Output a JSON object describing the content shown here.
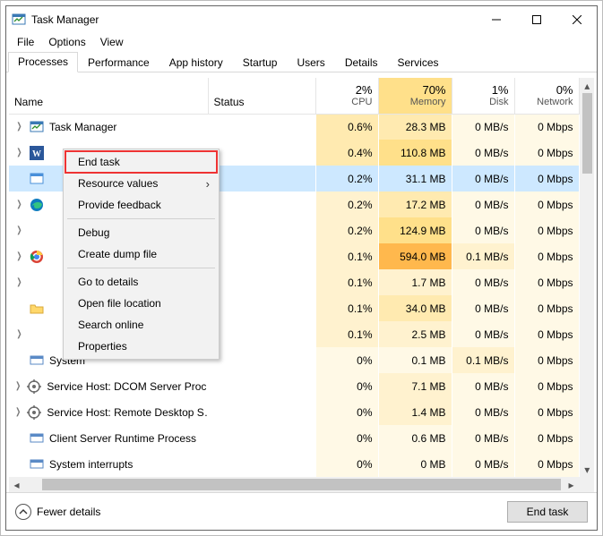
{
  "window": {
    "title": "Task Manager"
  },
  "menubar": [
    "File",
    "Options",
    "View"
  ],
  "tabs": [
    "Processes",
    "Performance",
    "App history",
    "Startup",
    "Users",
    "Details",
    "Services"
  ],
  "active_tab": 0,
  "columns": {
    "name": "Name",
    "status": "Status",
    "cpu": {
      "pct": "2%",
      "label": "CPU"
    },
    "mem": {
      "pct": "70%",
      "label": "Memory"
    },
    "disk": {
      "pct": "1%",
      "label": "Disk"
    },
    "net": {
      "pct": "0%",
      "label": "Network"
    }
  },
  "rows": [
    {
      "icon": "tm",
      "expand": true,
      "name": "Task Manager",
      "cpu": "0.6%",
      "mem": "28.3 MB",
      "disk": "0 MB/s",
      "net": "0 Mbps",
      "cpu_h": "heat2",
      "mem_h": "heat2",
      "disk_h": "heat0",
      "net_h": "heat0"
    },
    {
      "icon": "word",
      "expand": true,
      "name": "",
      "cpu": "0.4%",
      "mem": "110.8 MB",
      "disk": "0 MB/s",
      "net": "0 Mbps",
      "cpu_h": "heat2",
      "mem_h": "heat3",
      "disk_h": "heat0",
      "net_h": "heat0"
    },
    {
      "icon": "winexp",
      "expand": false,
      "name": "",
      "cpu": "0.2%",
      "mem": "31.1 MB",
      "disk": "0 MB/s",
      "net": "0 Mbps",
      "cpu_h": "heat1",
      "mem_h": "heat2",
      "disk_h": "heat0",
      "net_h": "heat0",
      "selected": true
    },
    {
      "icon": "edge",
      "expand": true,
      "name": "",
      "cpu": "0.2%",
      "mem": "17.2 MB",
      "disk": "0 MB/s",
      "net": "0 Mbps",
      "cpu_h": "heat1",
      "mem_h": "heat2",
      "disk_h": "heat0",
      "net_h": "heat0"
    },
    {
      "icon": "blank",
      "expand": true,
      "name": "",
      "cpu": "0.2%",
      "mem": "124.9 MB",
      "disk": "0 MB/s",
      "net": "0 Mbps",
      "cpu_h": "heat1",
      "mem_h": "heat3",
      "disk_h": "heat0",
      "net_h": "heat0"
    },
    {
      "icon": "chrome",
      "expand": true,
      "name": "",
      "cpu": "0.1%",
      "mem": "594.0 MB",
      "disk": "0.1 MB/s",
      "net": "0 Mbps",
      "cpu_h": "heat1",
      "mem_h": "heat5",
      "disk_h": "heat1",
      "net_h": "heat0"
    },
    {
      "icon": "blank",
      "expand": true,
      "name": "",
      "cpu": "0.1%",
      "mem": "1.7 MB",
      "disk": "0 MB/s",
      "net": "0 Mbps",
      "cpu_h": "heat1",
      "mem_h": "heat1",
      "disk_h": "heat0",
      "net_h": "heat0"
    },
    {
      "icon": "folder",
      "expand": false,
      "name": "",
      "cpu": "0.1%",
      "mem": "34.0 MB",
      "disk": "0 MB/s",
      "net": "0 Mbps",
      "cpu_h": "heat1",
      "mem_h": "heat2",
      "disk_h": "heat0",
      "net_h": "heat0"
    },
    {
      "icon": "blank",
      "expand": true,
      "name": "",
      "cpu": "0.1%",
      "mem": "2.5 MB",
      "disk": "0 MB/s",
      "net": "0 Mbps",
      "cpu_h": "heat1",
      "mem_h": "heat1",
      "disk_h": "heat0",
      "net_h": "heat0"
    },
    {
      "icon": "sys",
      "expand": false,
      "name": "System",
      "cpu": "0%",
      "mem": "0.1 MB",
      "disk": "0.1 MB/s",
      "net": "0 Mbps",
      "cpu_h": "heat0",
      "mem_h": "heat0",
      "disk_h": "heat1",
      "net_h": "heat0"
    },
    {
      "icon": "svc",
      "expand": true,
      "name": "Service Host: DCOM Server Proc…",
      "cpu": "0%",
      "mem": "7.1 MB",
      "disk": "0 MB/s",
      "net": "0 Mbps",
      "cpu_h": "heat0",
      "mem_h": "heat1",
      "disk_h": "heat0",
      "net_h": "heat0"
    },
    {
      "icon": "svc",
      "expand": true,
      "name": "Service Host: Remote Desktop S…",
      "cpu": "0%",
      "mem": "1.4 MB",
      "disk": "0 MB/s",
      "net": "0 Mbps",
      "cpu_h": "heat0",
      "mem_h": "heat1",
      "disk_h": "heat0",
      "net_h": "heat0"
    },
    {
      "icon": "sys",
      "expand": false,
      "name": "Client Server Runtime Process",
      "cpu": "0%",
      "mem": "0.6 MB",
      "disk": "0 MB/s",
      "net": "0 Mbps",
      "cpu_h": "heat0",
      "mem_h": "heat0",
      "disk_h": "heat0",
      "net_h": "heat0"
    },
    {
      "icon": "sys",
      "expand": false,
      "name": "System interrupts",
      "cpu": "0%",
      "mem": "0 MB",
      "disk": "0 MB/s",
      "net": "0 Mbps",
      "cpu_h": "heat0",
      "mem_h": "heat0",
      "disk_h": "heat0",
      "net_h": "heat0"
    }
  ],
  "context_menu": [
    {
      "label": "End task",
      "highlight": true
    },
    {
      "label": "Resource values",
      "submenu": true
    },
    {
      "label": "Provide feedback"
    },
    {
      "sep": true
    },
    {
      "label": "Debug"
    },
    {
      "label": "Create dump file"
    },
    {
      "sep": true
    },
    {
      "label": "Go to details"
    },
    {
      "label": "Open file location"
    },
    {
      "label": "Search online"
    },
    {
      "label": "Properties"
    }
  ],
  "footer": {
    "fewer": "Fewer details",
    "end_task": "End task"
  },
  "icons_svg": {
    "tm": "<svg width='16' height='16'><rect x='1' y='2' width='14' height='11' fill='#fff' stroke='#3a79b5'/><rect x='1' y='2' width='14' height='3' fill='#3a79b5'/><polyline points='3,10 6,7 8,9 12,5' fill='none' stroke='#2d8f2d' stroke-width='1.3'/></svg>",
    "word": "<svg width='16' height='16'><rect width='16' height='16' fill='#2b579a'/><text x='8' y='12' font-size='10' fill='#fff' text-anchor='middle' font-family='Segoe UI' font-weight='bold'>W</text></svg>",
    "winexp": "<svg width='16' height='16'><rect x='1' y='2' width='14' height='11' fill='#fff' stroke='#4a90d9'/><rect x='1' y='2' width='14' height='3' fill='#4a90d9'/></svg>",
    "edge": "<svg width='16' height='16'><circle cx='8' cy='8' r='7' fill='#0f7cbf'/><path d='M2 9 Q8 2 14 7 Q13 12 8 12 Q5 12 5 9 Q5 7 8 7' fill='#33c481'/></svg>",
    "chrome": "<svg width='16' height='16'><circle cx='8' cy='8' r='7' fill='#db4437'/><circle cx='8' cy='8' r='4.5' fill='#fff'/><circle cx='8' cy='8' r='3' fill='#4285f4'/><path d='M8 1 A7 7 0 0 1 14.5 6 L8 6 Z' fill='#ffcd40'/><path d='M2 12 A7 7 0 0 1 2 4 L6 9 Z' fill='#0f9d58'/></svg>",
    "folder": "<svg width='16' height='16'><path d='M1 4h5l1 2h8v7H1z' fill='#ffd86b' stroke='#d9a93a'/></svg>",
    "sys": "<svg width='16' height='16'><rect x='1' y='3' width='14' height='9' fill='#fff' stroke='#5a8ac6'/><rect x='1' y='3' width='14' height='3' fill='#5a8ac6'/></svg>",
    "svc": "<svg width='16' height='16'><circle cx='8' cy='8' r='6' fill='none' stroke='#6a6a6a' stroke-width='1.5'/><circle cx='8' cy='8' r='2' fill='#6a6a6a'/><g stroke='#6a6a6a' stroke-width='1.5'><line x1='8' y1='0' x2='8' y2='3'/><line x1='8' y1='13' x2='8' y2='16'/><line x1='0' y1='8' x2='3' y2='8'/><line x1='13' y1='8' x2='16' y2='8'/></g></svg>",
    "blank": "<svg width='16' height='16'></svg>",
    "app": "<svg width='16' height='16'><rect x='1' y='2' width='14' height='11' fill='#fff' stroke='#3a79b5'/><rect x='1' y='2' width='14' height='3' fill='#3a79b5'/><polyline points='3,10 6,7 8,9 12,5' fill='none' stroke='#2d8f2d' stroke-width='1.3'/></svg>"
  }
}
